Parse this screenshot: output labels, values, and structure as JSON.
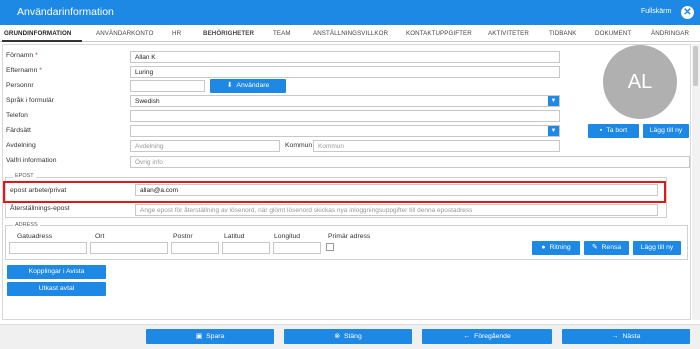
{
  "header": {
    "title": "Användarinformation",
    "fullscreen_label": "Fullskärm",
    "close_glyph": "✕"
  },
  "tabs": [
    "GRUNDINFORMATION",
    "ANVÄNDARKONTO",
    "HR",
    "BEHÖRIGHETER",
    "TEAM",
    "ANSTÄLLNINGSVILLKOR",
    "KONTAKTUPPGIFTER",
    "AKTIVITETER",
    "TIDBANK",
    "DOKUMENT",
    "ÄNDRINGAR"
  ],
  "form": {
    "fornamn": {
      "label": "Förnamn",
      "required_mark": "*",
      "value": "Allan K"
    },
    "efternamn": {
      "label": "Efternamn",
      "required_mark": "*",
      "value": "Luring"
    },
    "personnr": {
      "label": "Personnr",
      "value": ""
    },
    "anvandare_button": "Användare",
    "sprak": {
      "label": "Språk i formulär",
      "value": "Swedish"
    },
    "telefon": {
      "label": "Telefon",
      "value": ""
    },
    "fardsatt": {
      "label": "Färdsätt",
      "value": ""
    },
    "avdelning": {
      "label": "Avdelning",
      "placeholder": "Avdelning"
    },
    "kommun": {
      "label": "Kommun",
      "placeholder": "Kommun"
    },
    "valfri": {
      "label": "Valfri information",
      "placeholder": "Övrig info"
    }
  },
  "avatar": {
    "initials": "AL",
    "delete_label": "Ta bort",
    "add_label": "Lägg till ny"
  },
  "epost": {
    "section_title": "EPOST",
    "arbete_label": "epost arbete/privat",
    "arbete_value": "allan@a.com",
    "aterstallning_label": "Återställnings-epost",
    "aterstallning_placeholder": "Ange epost för återställning av lösenord, när glömt lösenord skickas nya inloggningsuppgifter till denna epostadress"
  },
  "adress": {
    "section_title": "ADRESS",
    "columns": [
      "Gatuadress",
      "Ort",
      "Postnr",
      "Latitud",
      "Longitud",
      "Primär adress"
    ],
    "ritning_label": "Ritning",
    "rensa_label": "Rensa",
    "add_label": "Lägg till ny"
  },
  "left_buttons": {
    "kopplingar": "Kopplingar i Avista",
    "utkast": "Utkast avtal"
  },
  "footer": {
    "spara": "Spara",
    "stang": "Stäng",
    "foregaende": "Föregående",
    "nasta": "Nästa"
  },
  "colors": {
    "accent": "#1e88e5",
    "highlight": "#e01818",
    "avatar": "#b0b0b0"
  }
}
